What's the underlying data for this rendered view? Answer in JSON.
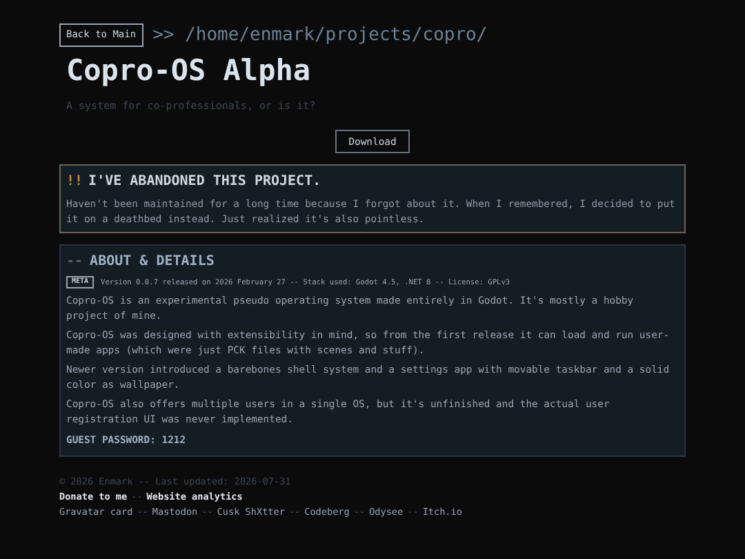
{
  "header": {
    "back_button": "Back to Main",
    "path": ">> /home/enmark/projects/copro/",
    "title": "Copro-OS Alpha",
    "subtitle": "A system for co-professionals, or is it?"
  },
  "download_button": "Download",
  "notice": {
    "marker": "!!",
    "title": "I'VE ABANDONED THIS PROJECT.",
    "text": "Haven't been maintained for a long time because I forgot about it. When I remembered, I decided to put it on a deathbed instead. Just realized it's also pointless."
  },
  "about": {
    "marker": "--",
    "title": "ABOUT & DETAILS",
    "meta_badge": "META",
    "meta_text": "Version 0.0.7 released on 2026 February 27 -- Stack used: Godot 4.5, .NET 8 -- License: GPLv3",
    "paragraphs": [
      "Copro-OS is an experimental pseudo operating system made entirely in Godot. It's mostly a hobby project of mine.",
      "Copro-OS was designed with extensibility in mind, so from the first release it can load and run user-made apps (which were just PCK files with scenes and stuff).",
      "Newer version introduced a barebones shell system and a settings app with movable taskbar and a solid color as wallpaper.",
      "Copro-OS also offers multiple users in a single OS, but it's unfinished and the actual user registration UI was never implemented."
    ],
    "password": "GUEST PASSWORD: 1212"
  },
  "footer": {
    "copyright": "© 2026 Enmark -- Last updated: 2026-07-31",
    "separator": "--",
    "primary_links": [
      "Donate to me",
      "Website analytics"
    ],
    "secondary_links": [
      "Gravatar card",
      "Mastodon",
      "Cusk ShXtter",
      "Codeberg",
      "Odysee",
      "Itch.io"
    ]
  }
}
